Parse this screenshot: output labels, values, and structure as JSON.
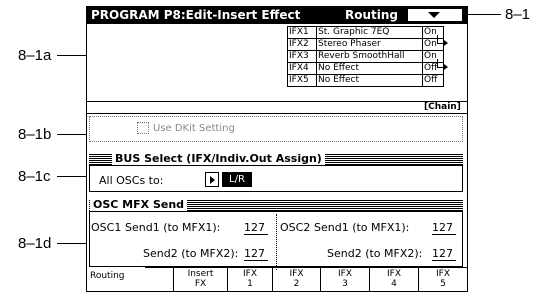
{
  "callouts": {
    "menu": "8–1",
    "ifx_area": "8–1a",
    "use_dkit": "8–1b",
    "bus_select": "8–1c",
    "osc_mfx": "8–1d"
  },
  "header": {
    "title": "PROGRAM P8:Edit-Insert Effect",
    "page_name": "Routing"
  },
  "ifx_table": [
    {
      "id": "IFX1",
      "name": "St. Graphic 7EQ",
      "state": "On"
    },
    {
      "id": "IFX2",
      "name": "Stereo Phaser",
      "state": "On"
    },
    {
      "id": "IFX3",
      "name": "Reverb SmoothHall",
      "state": "On"
    },
    {
      "id": "IFX4",
      "name": "No Effect",
      "state": "Off"
    },
    {
      "id": "IFX5",
      "name": "No Effect",
      "state": "Off"
    }
  ],
  "chain_label": "[Chain]",
  "use_dkit": {
    "label": "Use DKit Setting",
    "checked": false,
    "enabled": false
  },
  "bus_select": {
    "title": "BUS Select (IFX/Indiv.Out Assign)",
    "label": "All OSCs to:",
    "value": "L/R"
  },
  "osc_mfx": {
    "title": "OSC MFX Send",
    "osc1_label": "OSC1",
    "osc2_label": "OSC2",
    "send1_label": "Send1 (to MFX1):",
    "send2_label": "Send2 (to MFX2):",
    "osc1_send1": "127",
    "osc1_send2": "127",
    "osc2_send1": "127",
    "osc2_send2": "127"
  },
  "tabs": [
    {
      "line1": "Routing",
      "line2": ""
    },
    {
      "line1": "Insert",
      "line2": "FX"
    },
    {
      "line1": "IFX",
      "line2": "1"
    },
    {
      "line1": "IFX",
      "line2": "2"
    },
    {
      "line1": "IFX",
      "line2": "3"
    },
    {
      "line1": "IFX",
      "line2": "4"
    },
    {
      "line1": "IFX",
      "line2": "5"
    }
  ],
  "active_tab": "Routing"
}
